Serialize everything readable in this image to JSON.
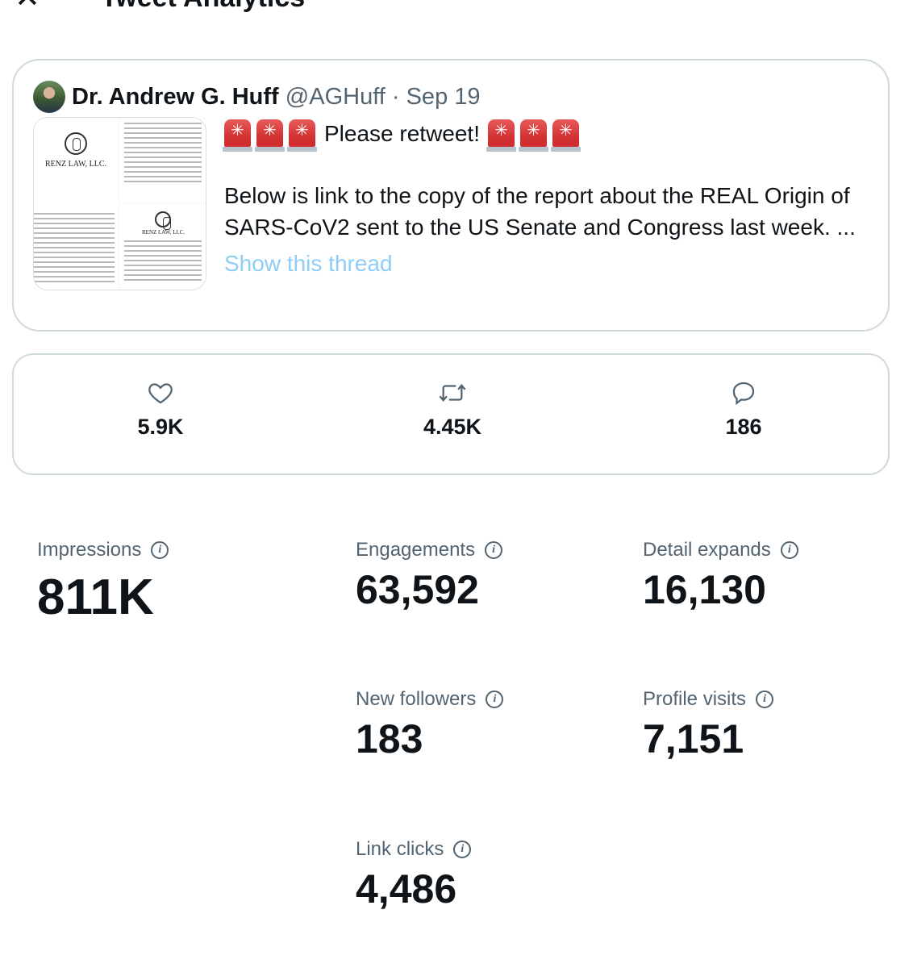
{
  "header": {
    "title": "Tweet Analytics",
    "close_icon": "close-icon"
  },
  "tweet": {
    "author_name": "Dr. Andrew G. Huff",
    "handle": "@AGHuff",
    "separator": "·",
    "date": "Sep 19",
    "lead_text": "Please retweet!",
    "siren_emoji": "🚨",
    "body": "Below is link to the copy of the report about the REAL Origin of SARS-CoV2 sent to the US Senate and Congress last week. ...",
    "show_thread": "Show this thread",
    "image_firm_name": "RENZ LAW, LLC.",
    "image_firm_name_small": "RENZ LAW, LLC."
  },
  "engagement": {
    "likes": "5.9K",
    "retweets": "4.45K",
    "replies": "186"
  },
  "stats": {
    "impressions": {
      "label": "Impressions",
      "value": "811K"
    },
    "engagements": {
      "label": "Engagements",
      "value": "63,592"
    },
    "detail_expands": {
      "label": "Detail expands",
      "value": "16,130"
    },
    "new_followers": {
      "label": "New followers",
      "value": "183"
    },
    "profile_visits": {
      "label": "Profile visits",
      "value": "7,151"
    },
    "link_clicks": {
      "label": "Link clicks",
      "value": "4,486"
    }
  },
  "colors": {
    "text": "#0f1419",
    "secondary": "#536471",
    "border": "#cfd9de",
    "link": "#8ecdf8"
  }
}
